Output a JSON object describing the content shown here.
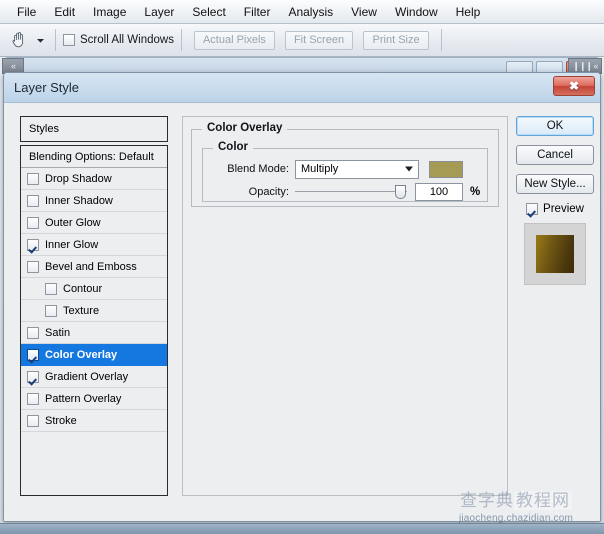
{
  "menubar": {
    "items": [
      {
        "label": "File"
      },
      {
        "label": "Edit"
      },
      {
        "label": "Image"
      },
      {
        "label": "Layer"
      },
      {
        "label": "Select"
      },
      {
        "label": "Filter"
      },
      {
        "label": "Analysis"
      },
      {
        "label": "View"
      },
      {
        "label": "Window"
      },
      {
        "label": "Help"
      }
    ]
  },
  "options_bar": {
    "tool_icon": "hand-tool-icon",
    "dropdown_icon": "chevron-down-icon",
    "scroll_all_windows": {
      "label": "Scroll All Windows",
      "checked": false
    },
    "buttons": [
      {
        "label": "Actual Pixels",
        "disabled": true
      },
      {
        "label": "Fit Screen",
        "disabled": true
      },
      {
        "label": "Print Size",
        "disabled": true
      }
    ],
    "dock_handle_left": "«",
    "dock_handle_right": "❙❙❙ «"
  },
  "document_window": {
    "title": "",
    "controls": [
      {
        "name": "minimize-button"
      },
      {
        "name": "maximize-button"
      },
      {
        "name": "close-button"
      }
    ]
  },
  "dialog": {
    "title": "Layer Style",
    "close_label": "✖"
  },
  "styles_panel": {
    "header": "Styles",
    "blending_options": {
      "label": "Blending Options: Default"
    },
    "items": [
      {
        "label": "Drop Shadow",
        "checked": false,
        "selected": false,
        "sub": false
      },
      {
        "label": "Inner Shadow",
        "checked": false,
        "selected": false,
        "sub": false
      },
      {
        "label": "Outer Glow",
        "checked": false,
        "selected": false,
        "sub": false
      },
      {
        "label": "Inner Glow",
        "checked": true,
        "selected": false,
        "sub": false
      },
      {
        "label": "Bevel and Emboss",
        "checked": false,
        "selected": false,
        "sub": false
      },
      {
        "label": "Contour",
        "checked": false,
        "selected": false,
        "sub": true
      },
      {
        "label": "Texture",
        "checked": false,
        "selected": false,
        "sub": true
      },
      {
        "label": "Satin",
        "checked": false,
        "selected": false,
        "sub": false
      },
      {
        "label": "Color Overlay",
        "checked": true,
        "selected": true,
        "sub": false
      },
      {
        "label": "Gradient Overlay",
        "checked": true,
        "selected": false,
        "sub": false
      },
      {
        "label": "Pattern Overlay",
        "checked": false,
        "selected": false,
        "sub": false
      },
      {
        "label": "Stroke",
        "checked": false,
        "selected": false,
        "sub": false
      }
    ]
  },
  "settings": {
    "group_title": "Color Overlay",
    "color_group_title": "Color",
    "blend_mode": {
      "label": "Blend Mode:",
      "value": "Multiply",
      "swatch_color": "#a69b55",
      "arrow_icon": "chevron-down-icon"
    },
    "opacity": {
      "label": "Opacity:",
      "value": "100",
      "unit": "%",
      "slider_percent": 100
    }
  },
  "right_column": {
    "ok_label": "OK",
    "cancel_label": "Cancel",
    "new_style_label": "New Style...",
    "preview": {
      "label": "Preview",
      "checked": true
    },
    "thumbnail_color": "#6d5512"
  },
  "watermark": {
    "cn_left": "查字典",
    "cn_right": "教程网",
    "url": "jiaocheng.chazidian.com"
  }
}
